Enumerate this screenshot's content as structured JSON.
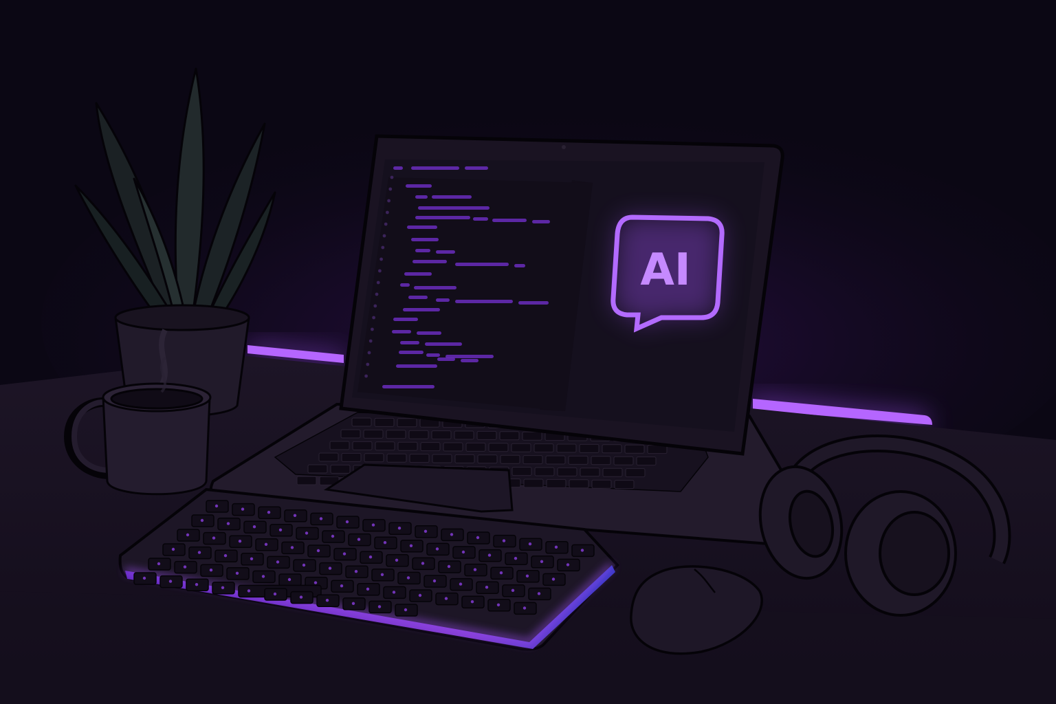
{
  "screen": {
    "ai_badge_text": "AI"
  },
  "colors": {
    "background": "#0b0714",
    "desk": "#1a1322",
    "accent": "#8b3fe0",
    "accent_glow": "#b36bff",
    "screen_bg": "#15101e",
    "outline": "#050308"
  },
  "icons": {
    "chat_badge": "chat-bubble-icon"
  }
}
